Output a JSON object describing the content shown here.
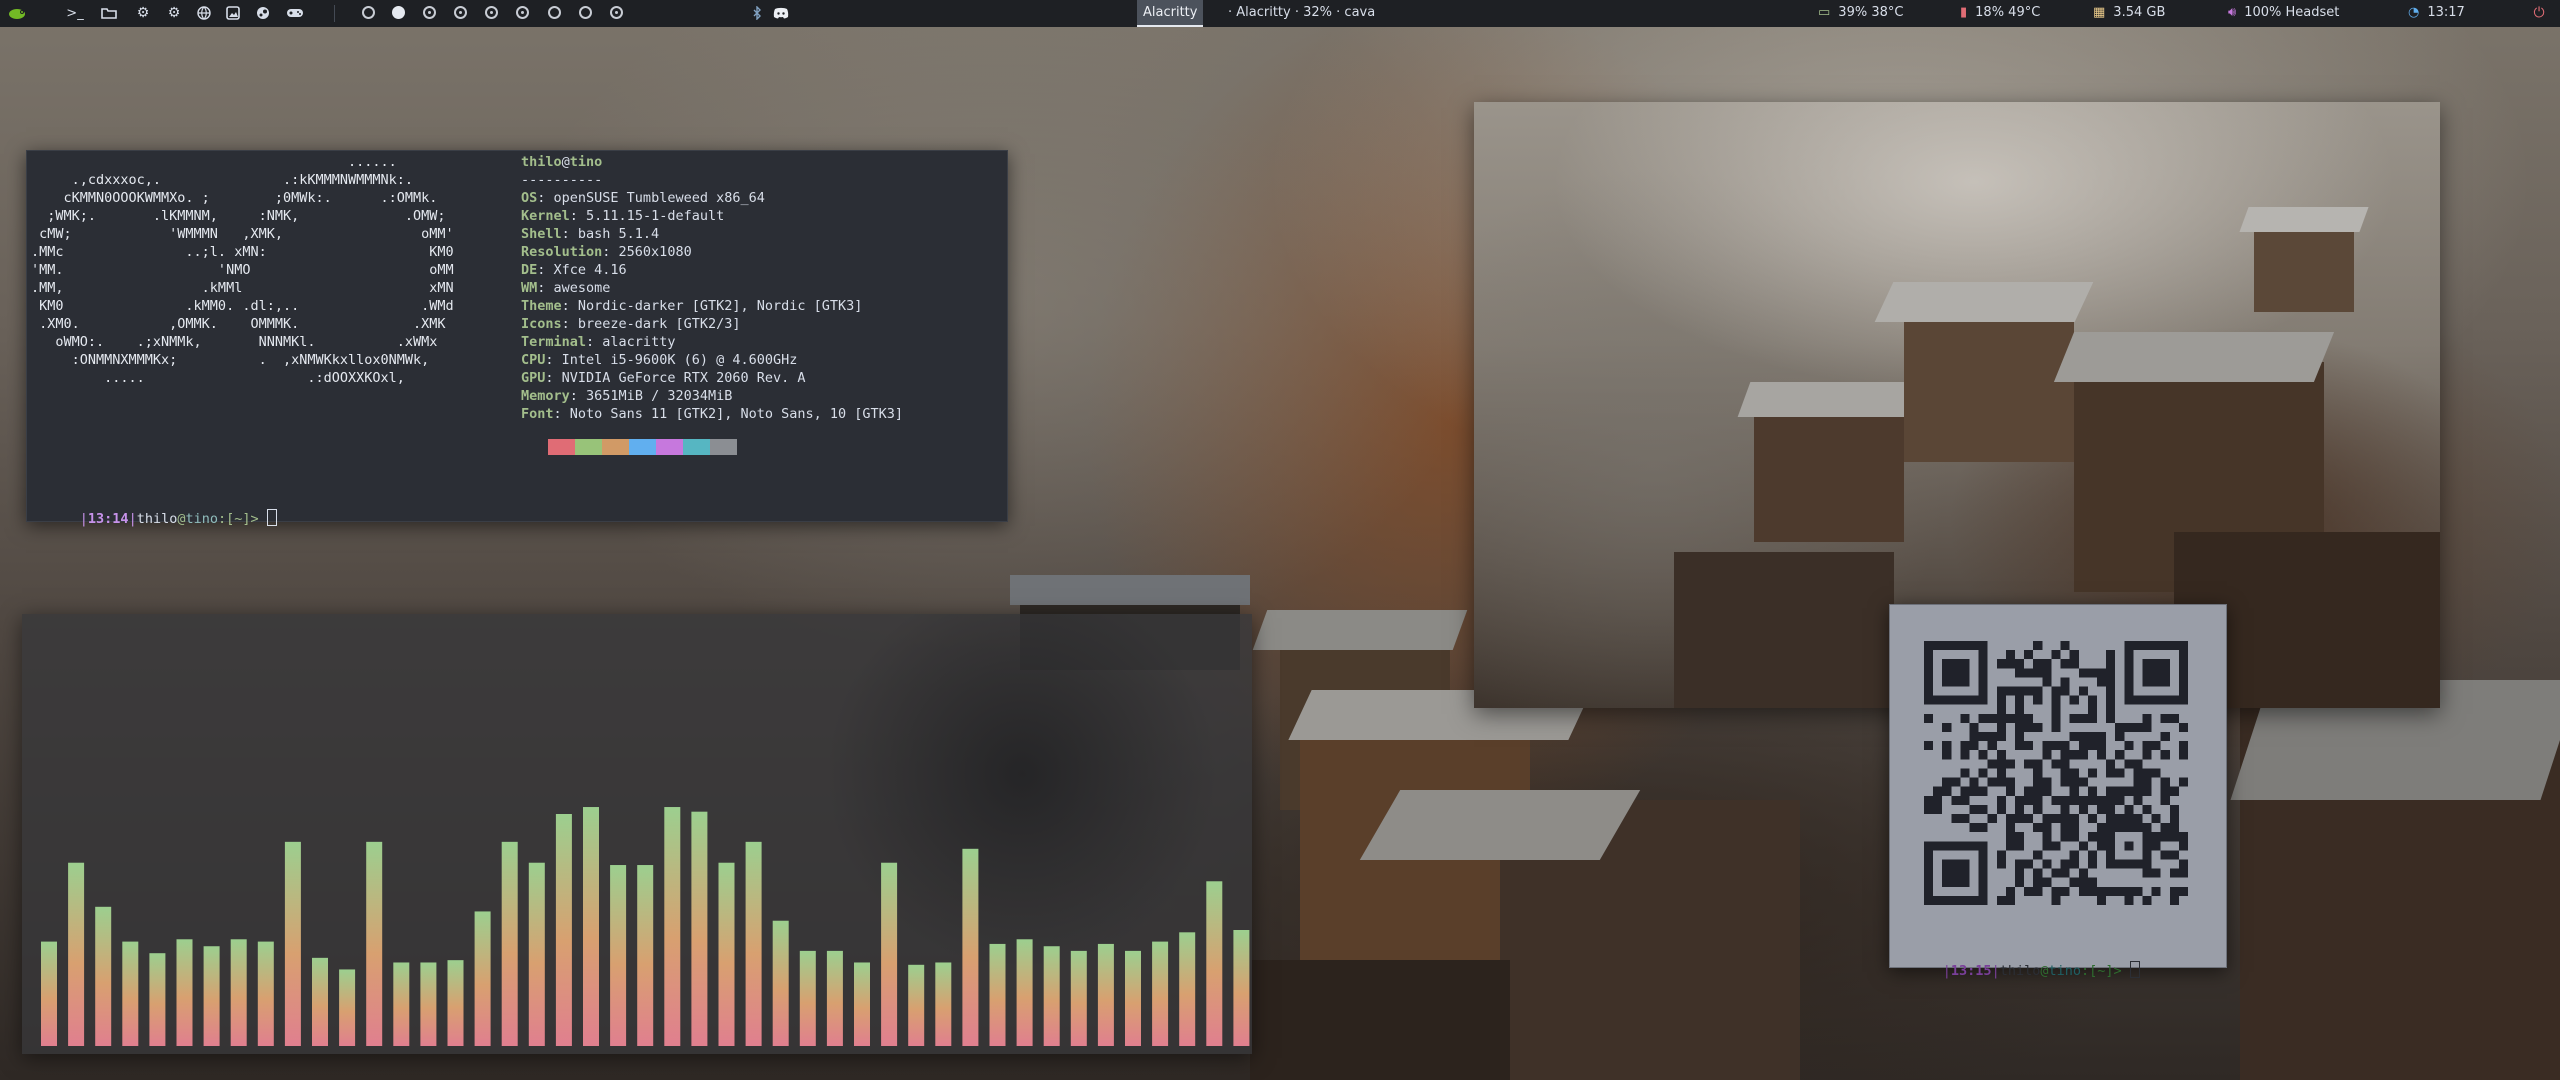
{
  "topbar": {
    "launchers": [
      "opensuse-logo-icon",
      "terminal-icon",
      "folder-icon",
      "settings-icon",
      "system-settings-icon",
      "globe-icon",
      "image-viewer-icon",
      "steam-icon",
      "gamepad-icon"
    ],
    "workspaces": [
      "ring",
      "active",
      "dot",
      "dot",
      "dot",
      "dot",
      "ring",
      "ring",
      "dot"
    ],
    "tray": [
      "bluetooth-icon",
      "discord-icon"
    ],
    "tasks": {
      "active": "Alacritty",
      "other": "· Alacritty · 32% · cava"
    },
    "stats": {
      "cpu": "39%  38°C",
      "gpu": "18%  49°C",
      "ram": "3.54 GB",
      "volume": "100% Headset",
      "clock": "13:17"
    }
  },
  "neofetch": {
    "ascii": "                                       ......\n     .,cdxxxoc,.               .:kKMMMNWMMMNk:.\n    cKMMN0OOOKWMMXo. ;        ;0MWk:.      .:OMMk.\n  ;WMK;.       .lKMMNM,     :NMK,             .OMW;\n cMW;            'WMMMN   ,XMK,                 oMM'\n.MMc               ..;l. xMN:                    KM0\n'MM.                   'NMO                      oMM\n.MM,                 .kMMl                       xMN\n KM0               .kMM0. .dl:,..               .WMd\n .XM0.           ,OMMK.    OMMMK.              .XMK\n   oWMO:.    .;xNMMk,       NNNMKl.          .xWMx\n     :ONMMNXMMMKx;          .  ,xNMWKkxllox0NMWk,\n         .....                    .:dOOXXKOxl,",
    "user": "thilo",
    "at": "@",
    "host": "tino",
    "separator": "----------",
    "fields": [
      {
        "key": "OS",
        "value": "openSUSE Tumbleweed x86_64"
      },
      {
        "key": "Kernel",
        "value": "5.11.15-1-default"
      },
      {
        "key": "Shell",
        "value": "bash 5.1.4"
      },
      {
        "key": "Resolution",
        "value": "2560x1080"
      },
      {
        "key": "DE",
        "value": "Xfce 4.16"
      },
      {
        "key": "WM",
        "value": "awesome"
      },
      {
        "key": "Theme",
        "value": "Nordic-darker [GTK2], Nordic [GTK3]"
      },
      {
        "key": "Icons",
        "value": "breeze-dark [GTK2/3]"
      },
      {
        "key": "Terminal",
        "value": "alacritty"
      },
      {
        "key": "CPU",
        "value": "Intel i5-9600K (6) @ 4.600GHz"
      },
      {
        "key": "GPU",
        "value": "NVIDIA GeForce RTX 2060 Rev. A"
      },
      {
        "key": "Memory",
        "value": "3651MiB / 32034MiB"
      },
      {
        "key": "Font",
        "value": "Noto Sans 11 [GTK2], Noto Sans, 10 [GTK3]"
      }
    ],
    "palette": [
      "#2b2e35",
      "#e06c75",
      "#98c379",
      "#d19a66",
      "#61afef",
      "#c678dd",
      "#56b6c2",
      "#8b8e93"
    ],
    "prompt": {
      "time": "13:14",
      "user": "thilo",
      "at": "@",
      "host": "tino",
      "path": ":[~]>"
    }
  },
  "cava": {
    "levels": [
      0.45,
      0.79,
      0.6,
      0.45,
      0.4,
      0.46,
      0.43,
      0.46,
      0.45,
      0.88,
      0.38,
      0.33,
      0.88,
      0.36,
      0.36,
      0.37,
      0.58,
      0.88,
      0.79,
      1.0,
      1.03,
      0.78,
      0.78,
      1.03,
      1.01,
      0.79,
      0.88,
      0.54,
      0.41,
      0.41,
      0.36,
      0.79,
      0.35,
      0.36,
      0.85,
      0.44,
      0.46,
      0.43,
      0.41,
      0.44,
      0.41,
      0.45,
      0.49,
      0.71,
      0.5
    ],
    "gradient_top": "#9ccf8f",
    "gradient_bottom": "#e07f8f"
  },
  "qr_terminal": {
    "prompt": {
      "time": "13:15",
      "user": "thilo",
      "at": "@",
      "host": "tino",
      "path": ":[~]>"
    }
  }
}
